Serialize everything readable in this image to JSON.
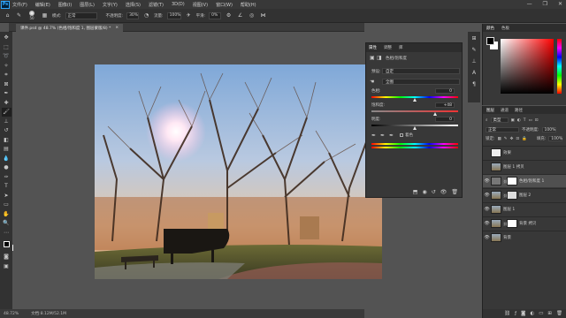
{
  "app": {
    "logo": "Ps"
  },
  "menu": [
    "文件(F)",
    "编辑(E)",
    "图像(I)",
    "图层(L)",
    "文字(Y)",
    "选择(S)",
    "滤镜(T)",
    "3D(D)",
    "视图(V)",
    "窗口(W)",
    "帮助(H)"
  ],
  "window_controls": [
    "—",
    "❐",
    "✕"
  ],
  "options": {
    "brush_size": "50",
    "mode_label": "模式:",
    "mode_value": "正常",
    "opacity_label": "不透明度:",
    "opacity_value": "30%",
    "flow_label": "流量:",
    "flow_value": "100%",
    "smooth_label": "平滑:",
    "smooth_value": "0%"
  },
  "document_tab": {
    "title": "课件.psd @ 48.7% (色相/饱和度 1, 图层蒙版/8) *",
    "close": "×"
  },
  "status": {
    "zoom": "48.72%",
    "info": "文档:8.12M/52.1M"
  },
  "properties": {
    "tabs": [
      "属性",
      "调整",
      "库"
    ],
    "title": "色相/饱和度",
    "preset_label": "预设:",
    "preset_value": "自定",
    "channel_value": "全图",
    "hue_label": "色相:",
    "hue_value": "0",
    "hue_level": 0.5,
    "saturation_label": "饱和度:",
    "saturation_value": "+48",
    "saturation_level": 0.74,
    "lightness_label": "明度:",
    "lightness_value": "0",
    "lightness_level": 0.5,
    "colorize_label": "着色"
  },
  "color_panel": {
    "tabs": [
      "颜色",
      "色板"
    ]
  },
  "layers_panel": {
    "tabs": [
      "图层",
      "通道",
      "路径"
    ],
    "kind_label": "类型",
    "blend_mode": "正常",
    "opacity_label": "不透明度:",
    "opacity_value": "100%",
    "lock_label": "锁定:",
    "fill_label": "填充:",
    "fill_value": "100%",
    "layers": [
      {
        "name": "效果"
      },
      {
        "name": "图层 1 拷贝"
      },
      {
        "name": "色相/饱和度 1"
      },
      {
        "name": "图层 2"
      },
      {
        "name": "图层 1"
      },
      {
        "name": "背景 拷贝"
      },
      {
        "name": "背景"
      }
    ]
  }
}
